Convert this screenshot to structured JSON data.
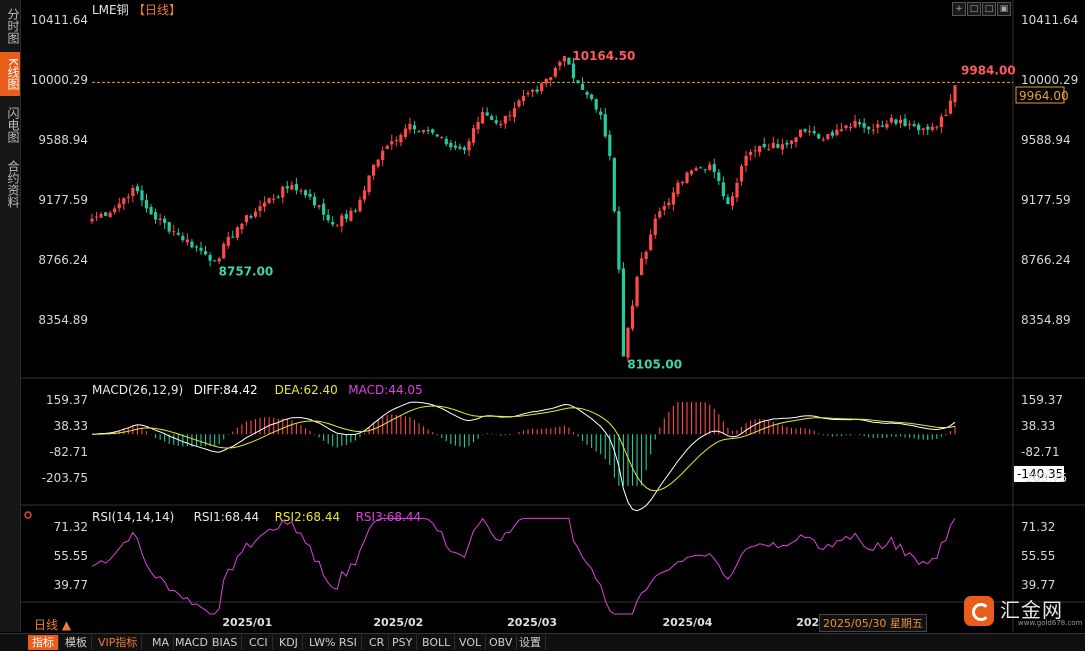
{
  "sidebar": {
    "tabs": [
      {
        "label": "分时图",
        "active": false
      },
      {
        "label": "K线图",
        "active": true
      },
      {
        "label": "闪电图",
        "active": false
      },
      {
        "label": "合约资料",
        "active": false
      }
    ]
  },
  "header": {
    "title": "LME铜",
    "period_tag": "【日线】",
    "toolbar_icons": [
      "crosshair-icon",
      "zoom-in-icon",
      "zoom-out-icon",
      "settings-icon"
    ]
  },
  "period_label": "日线",
  "bottom_bar": [
    "指标",
    "模板",
    "VIP指标",
    "MA",
    "MACD",
    "BIAS",
    "CCI",
    "KDJ",
    "LW%",
    "RSI",
    "CR",
    "PSY",
    "BOLL",
    "VOL",
    "OBV",
    "设置"
  ],
  "date_cursor": "2025/05/30 星期五",
  "logo": {
    "text": "汇金网",
    "url": "www.gold678.com"
  },
  "chart_data": [
    {
      "type": "candlestick",
      "title": "LME铜",
      "ylim": [
        8150,
        10500
      ],
      "y_ticks": [
        "10411.64",
        "10000.29",
        "9588.94",
        "9177.59",
        "8766.24",
        "8354.89"
      ],
      "x_ticks": [
        "2025/01",
        "2025/02",
        "2025/03",
        "2025/04",
        "2025/05"
      ],
      "annotations": {
        "high": "10164.50",
        "low": "8105.00",
        "last_high": "9984.00",
        "mid_low": "8757.00"
      },
      "last_price": "9964.00",
      "last_price_line": 9984,
      "colors": {
        "up": "#ff4a4a",
        "down": "#27c9a0",
        "grid": "#2a2a2a",
        "text": "#c8c8c8"
      },
      "waypoints": [
        [
          0,
          9050
        ],
        [
          5,
          9120
        ],
        [
          9,
          9260
        ],
        [
          13,
          9080
        ],
        [
          19,
          8940
        ],
        [
          24,
          8830
        ],
        [
          27,
          8757
        ],
        [
          32,
          8990
        ],
        [
          38,
          9160
        ],
        [
          44,
          9280
        ],
        [
          48,
          9200
        ],
        [
          53,
          9010
        ],
        [
          58,
          9100
        ],
        [
          62,
          9420
        ],
        [
          66,
          9580
        ],
        [
          70,
          9700
        ],
        [
          74,
          9650
        ],
        [
          78,
          9560
        ],
        [
          82,
          9520
        ],
        [
          86,
          9780
        ],
        [
          90,
          9700
        ],
        [
          94,
          9860
        ],
        [
          98,
          9920
        ],
        [
          101,
          10020
        ],
        [
          104,
          10164
        ],
        [
          107,
          9980
        ],
        [
          110,
          9870
        ],
        [
          112,
          9760
        ],
        [
          114,
          9480
        ],
        [
          116,
          8700
        ],
        [
          117,
          8105
        ],
        [
          120,
          8650
        ],
        [
          124,
          9050
        ],
        [
          128,
          9230
        ],
        [
          132,
          9380
        ],
        [
          136,
          9420
        ],
        [
          140,
          9150
        ],
        [
          144,
          9480
        ],
        [
          148,
          9540
        ],
        [
          152,
          9560
        ],
        [
          156,
          9660
        ],
        [
          160,
          9600
        ],
        [
          164,
          9660
        ],
        [
          168,
          9720
        ],
        [
          172,
          9660
        ],
        [
          176,
          9740
        ],
        [
          180,
          9700
        ],
        [
          184,
          9660
        ],
        [
          188,
          9760
        ],
        [
          190,
          9964
        ]
      ],
      "n_bars": 191
    },
    {
      "type": "line",
      "title": "MACD(26,12,9)",
      "series": [
        {
          "name": "DIFF",
          "value": "84.42",
          "color": "#ffffff"
        },
        {
          "name": "DEA",
          "value": "62.40",
          "color": "#e8e830"
        },
        {
          "name": "MACD",
          "value": "44.05",
          "color": "#e040e0"
        }
      ],
      "ylim": [
        -260,
        190
      ],
      "y_ticks": [
        "159.37",
        "38.33",
        "-82.71",
        "-203.75"
      ],
      "cursor_value": "-140.35"
    },
    {
      "type": "line",
      "title": "RSI(14,14,14)",
      "series": [
        {
          "name": "RSI1",
          "value": "68.44",
          "color": "#e8e8e8"
        },
        {
          "name": "RSI2",
          "value": "68.44",
          "color": "#e8e830"
        },
        {
          "name": "RSI3",
          "value": "68.44",
          "color": "#e040e0"
        }
      ],
      "ylim": [
        22,
        80
      ],
      "y_ticks": [
        "71.32",
        "55.55",
        "39.77"
      ]
    }
  ]
}
